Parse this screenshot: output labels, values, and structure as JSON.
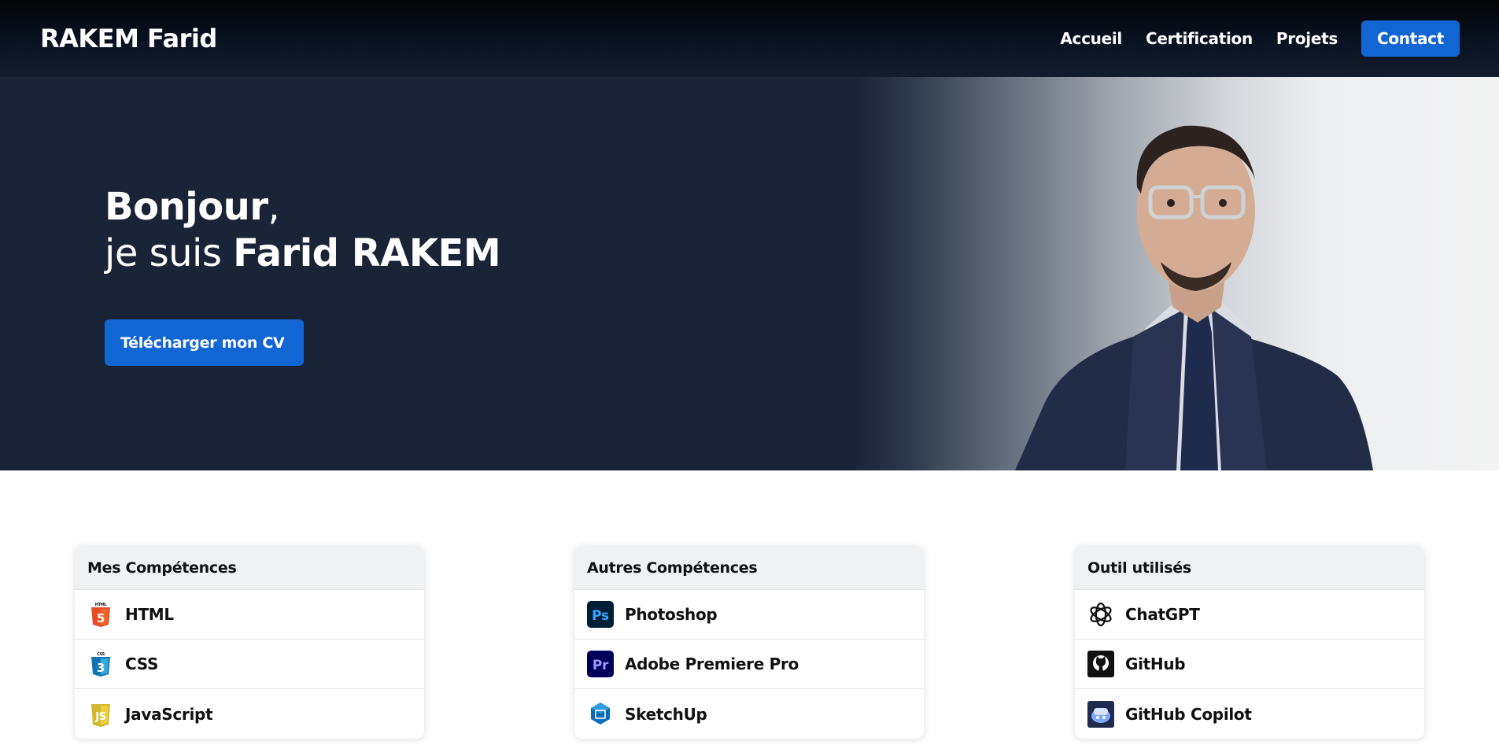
{
  "nav": {
    "brand": "RAKEM Farid",
    "links": [
      {
        "label": "Accueil"
      },
      {
        "label": "Certification"
      },
      {
        "label": "Projets"
      },
      {
        "label": "Contact"
      }
    ]
  },
  "hero": {
    "greeting_bold": "Bonjour",
    "greeting_rest": ",",
    "intro": "je suis ",
    "name": "Farid RAKEM",
    "cv_button": "Télécharger mon CV"
  },
  "cards": [
    {
      "title": "Mes Compétences",
      "items": [
        {
          "label": "HTML",
          "icon": "html5-icon"
        },
        {
          "label": "CSS",
          "icon": "css3-icon"
        },
        {
          "label": "JavaScript",
          "icon": "javascript-icon"
        }
      ]
    },
    {
      "title": "Autres Compétences",
      "items": [
        {
          "label": "Photoshop",
          "icon": "photoshop-icon"
        },
        {
          "label": "Adobe Premiere Pro",
          "icon": "premiere-pro-icon"
        },
        {
          "label": "SketchUp",
          "icon": "sketchup-icon"
        }
      ]
    },
    {
      "title": "Outil utilisés",
      "items": [
        {
          "label": "ChatGPT",
          "icon": "chatgpt-icon"
        },
        {
          "label": "GitHub",
          "icon": "github-icon"
        },
        {
          "label": "GitHub Copilot",
          "icon": "github-copilot-icon"
        }
      ]
    }
  ],
  "colors": {
    "accent": "#1266d4",
    "hero_bg": "#1b2436",
    "nav_bg": "#0b1322"
  }
}
